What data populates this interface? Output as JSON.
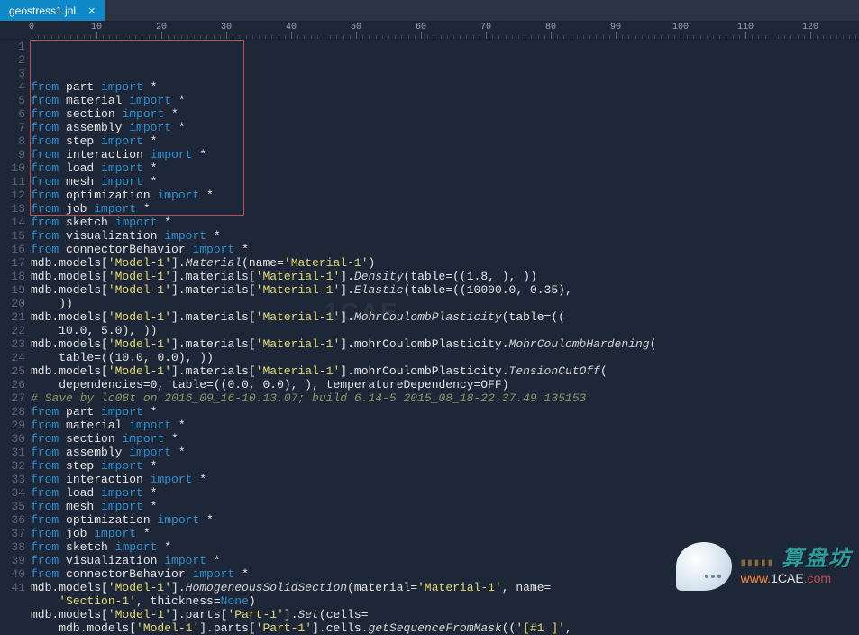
{
  "tab": {
    "filename": "geostress1.jnl"
  },
  "ruler": {
    "start": 0,
    "end": 130,
    "step": 10,
    "minor": 5
  },
  "highlight": {
    "top": 0,
    "lines": 13,
    "left": 0,
    "width_ch": 33
  },
  "watermarks": {
    "site_cn": "算盘坊",
    "url_prefix": "www.",
    "url_mid": "1CAE",
    "url_suffix": ".com",
    "center_text": "1CAE"
  },
  "code_lines": [
    [
      [
        "kw",
        "from"
      ],
      [
        "txt",
        " part "
      ],
      [
        "kw",
        "import"
      ],
      [
        "txt",
        " *"
      ]
    ],
    [
      [
        "kw",
        "from"
      ],
      [
        "txt",
        " material "
      ],
      [
        "kw",
        "import"
      ],
      [
        "txt",
        " *"
      ]
    ],
    [
      [
        "kw",
        "from"
      ],
      [
        "txt",
        " section "
      ],
      [
        "kw",
        "import"
      ],
      [
        "txt",
        " *"
      ]
    ],
    [
      [
        "kw",
        "from"
      ],
      [
        "txt",
        " assembly "
      ],
      [
        "kw",
        "import"
      ],
      [
        "txt",
        " *"
      ]
    ],
    [
      [
        "kw",
        "from"
      ],
      [
        "txt",
        " step "
      ],
      [
        "kw",
        "import"
      ],
      [
        "txt",
        " *"
      ]
    ],
    [
      [
        "kw",
        "from"
      ],
      [
        "txt",
        " interaction "
      ],
      [
        "kw",
        "import"
      ],
      [
        "txt",
        " *"
      ]
    ],
    [
      [
        "kw",
        "from"
      ],
      [
        "txt",
        " load "
      ],
      [
        "kw",
        "import"
      ],
      [
        "txt",
        " *"
      ]
    ],
    [
      [
        "kw",
        "from"
      ],
      [
        "txt",
        " mesh "
      ],
      [
        "kw",
        "import"
      ],
      [
        "txt",
        " *"
      ]
    ],
    [
      [
        "kw",
        "from"
      ],
      [
        "txt",
        " optimization "
      ],
      [
        "kw",
        "import"
      ],
      [
        "txt",
        " *"
      ]
    ],
    [
      [
        "kw",
        "from"
      ],
      [
        "txt",
        " job "
      ],
      [
        "kw",
        "import"
      ],
      [
        "txt",
        " *"
      ]
    ],
    [
      [
        "kw",
        "from"
      ],
      [
        "txt",
        " sketch "
      ],
      [
        "kw",
        "import"
      ],
      [
        "txt",
        " *"
      ]
    ],
    [
      [
        "kw",
        "from"
      ],
      [
        "txt",
        " visualization "
      ],
      [
        "kw",
        "import"
      ],
      [
        "txt",
        " *"
      ]
    ],
    [
      [
        "kw",
        "from"
      ],
      [
        "txt",
        " connectorBehavior "
      ],
      [
        "kw",
        "import"
      ],
      [
        "txt",
        " *"
      ]
    ],
    [
      [
        "txt",
        "mdb.models["
      ],
      [
        "str",
        "'Model-1'"
      ],
      [
        "txt",
        "]."
      ],
      [
        "fn",
        "Material"
      ],
      [
        "txt",
        "(name="
      ],
      [
        "str",
        "'Material-1'"
      ],
      [
        "txt",
        ")"
      ]
    ],
    [
      [
        "txt",
        "mdb.models["
      ],
      [
        "str",
        "'Model-1'"
      ],
      [
        "txt",
        "].materials["
      ],
      [
        "str",
        "'Material-1'"
      ],
      [
        "txt",
        "]."
      ],
      [
        "fn",
        "Density"
      ],
      [
        "txt",
        "(table=(("
      ],
      [
        "num-lit",
        "1.8"
      ],
      [
        "txt",
        ", ), ))"
      ]
    ],
    [
      [
        "txt",
        "mdb.models["
      ],
      [
        "str",
        "'Model-1'"
      ],
      [
        "txt",
        "].materials["
      ],
      [
        "str",
        "'Material-1'"
      ],
      [
        "txt",
        "]."
      ],
      [
        "fn",
        "Elastic"
      ],
      [
        "txt",
        "(table=(("
      ],
      [
        "num-lit",
        "10000.0"
      ],
      [
        "txt",
        ", "
      ],
      [
        "num-lit",
        "0.35"
      ],
      [
        "txt",
        "), "
      ]
    ],
    [
      [
        "txt",
        "    ))"
      ]
    ],
    [
      [
        "txt",
        "mdb.models["
      ],
      [
        "str",
        "'Model-1'"
      ],
      [
        "txt",
        "].materials["
      ],
      [
        "str",
        "'Material-1'"
      ],
      [
        "txt",
        "]."
      ],
      [
        "fn",
        "MohrCoulombPlasticity"
      ],
      [
        "txt",
        "(table=(("
      ]
    ],
    [
      [
        "txt",
        "    "
      ],
      [
        "num-lit",
        "10.0"
      ],
      [
        "txt",
        ", "
      ],
      [
        "num-lit",
        "5.0"
      ],
      [
        "txt",
        "), ))"
      ]
    ],
    [
      [
        "txt",
        "mdb.models["
      ],
      [
        "str",
        "'Model-1'"
      ],
      [
        "txt",
        "].materials["
      ],
      [
        "str",
        "'Material-1'"
      ],
      [
        "txt",
        "].mohrCoulombPlasticity."
      ],
      [
        "fn",
        "MohrCoulombHardening"
      ],
      [
        "txt",
        "("
      ]
    ],
    [
      [
        "txt",
        "    table=(("
      ],
      [
        "num-lit",
        "10.0"
      ],
      [
        "txt",
        ", "
      ],
      [
        "num-lit",
        "0.0"
      ],
      [
        "txt",
        "), ))"
      ]
    ],
    [
      [
        "txt",
        "mdb.models["
      ],
      [
        "str",
        "'Model-1'"
      ],
      [
        "txt",
        "].materials["
      ],
      [
        "str",
        "'Material-1'"
      ],
      [
        "txt",
        "].mohrCoulombPlasticity."
      ],
      [
        "fn",
        "TensionCutOff"
      ],
      [
        "txt",
        "("
      ]
    ],
    [
      [
        "txt",
        "    dependencies="
      ],
      [
        "num-lit",
        "0"
      ],
      [
        "txt",
        ", table=(("
      ],
      [
        "num-lit",
        "0.0"
      ],
      [
        "txt",
        ", "
      ],
      [
        "num-lit",
        "0.0"
      ],
      [
        "txt",
        "), ), temperatureDependency=OFF)"
      ]
    ],
    [
      [
        "com",
        "# Save by lc08t on 2016_09_16-10.13.07; build 6.14-5 2015_08_18-22.37.49 135153"
      ]
    ],
    [
      [
        "kw",
        "from"
      ],
      [
        "txt",
        " part "
      ],
      [
        "kw",
        "import"
      ],
      [
        "txt",
        " *"
      ]
    ],
    [
      [
        "kw",
        "from"
      ],
      [
        "txt",
        " material "
      ],
      [
        "kw",
        "import"
      ],
      [
        "txt",
        " *"
      ]
    ],
    [
      [
        "kw",
        "from"
      ],
      [
        "txt",
        " section "
      ],
      [
        "kw",
        "import"
      ],
      [
        "txt",
        " *"
      ]
    ],
    [
      [
        "kw",
        "from"
      ],
      [
        "txt",
        " assembly "
      ],
      [
        "kw",
        "import"
      ],
      [
        "txt",
        " *"
      ]
    ],
    [
      [
        "kw",
        "from"
      ],
      [
        "txt",
        " step "
      ],
      [
        "kw",
        "import"
      ],
      [
        "txt",
        " *"
      ]
    ],
    [
      [
        "kw",
        "from"
      ],
      [
        "txt",
        " interaction "
      ],
      [
        "kw",
        "import"
      ],
      [
        "txt",
        " *"
      ]
    ],
    [
      [
        "kw",
        "from"
      ],
      [
        "txt",
        " load "
      ],
      [
        "kw",
        "import"
      ],
      [
        "txt",
        " *"
      ]
    ],
    [
      [
        "kw",
        "from"
      ],
      [
        "txt",
        " mesh "
      ],
      [
        "kw",
        "import"
      ],
      [
        "txt",
        " *"
      ]
    ],
    [
      [
        "kw",
        "from"
      ],
      [
        "txt",
        " optimization "
      ],
      [
        "kw",
        "import"
      ],
      [
        "txt",
        " *"
      ]
    ],
    [
      [
        "kw",
        "from"
      ],
      [
        "txt",
        " job "
      ],
      [
        "kw",
        "import"
      ],
      [
        "txt",
        " *"
      ]
    ],
    [
      [
        "kw",
        "from"
      ],
      [
        "txt",
        " sketch "
      ],
      [
        "kw",
        "import"
      ],
      [
        "txt",
        " *"
      ]
    ],
    [
      [
        "kw",
        "from"
      ],
      [
        "txt",
        " visualization "
      ],
      [
        "kw",
        "import"
      ],
      [
        "txt",
        " *"
      ]
    ],
    [
      [
        "kw",
        "from"
      ],
      [
        "txt",
        " connectorBehavior "
      ],
      [
        "kw",
        "import"
      ],
      [
        "txt",
        " *"
      ]
    ],
    [
      [
        "txt",
        "mdb.models["
      ],
      [
        "str",
        "'Model-1'"
      ],
      [
        "txt",
        "]."
      ],
      [
        "fn",
        "HomogeneousSolidSection"
      ],
      [
        "txt",
        "(material="
      ],
      [
        "str",
        "'Material-1'"
      ],
      [
        "txt",
        ", name="
      ]
    ],
    [
      [
        "txt",
        "    "
      ],
      [
        "str",
        "'Section-1'"
      ],
      [
        "txt",
        ", thickness="
      ],
      [
        "kw",
        "None"
      ],
      [
        "txt",
        ")"
      ]
    ],
    [
      [
        "txt",
        "mdb.models["
      ],
      [
        "str",
        "'Model-1'"
      ],
      [
        "txt",
        "].parts["
      ],
      [
        "str",
        "'Part-1'"
      ],
      [
        "txt",
        "]."
      ],
      [
        "fn",
        "Set"
      ],
      [
        "txt",
        "(cells="
      ]
    ],
    [
      [
        "txt",
        "    mdb.models["
      ],
      [
        "str",
        "'Model-1'"
      ],
      [
        "txt",
        "].parts["
      ],
      [
        "str",
        "'Part-1'"
      ],
      [
        "txt",
        "].cells."
      ],
      [
        "fn",
        "getSequenceFromMask"
      ],
      [
        "txt",
        "(("
      ],
      [
        "str",
        "'[#1 ]'"
      ],
      [
        "txt",
        ", "
      ]
    ]
  ]
}
